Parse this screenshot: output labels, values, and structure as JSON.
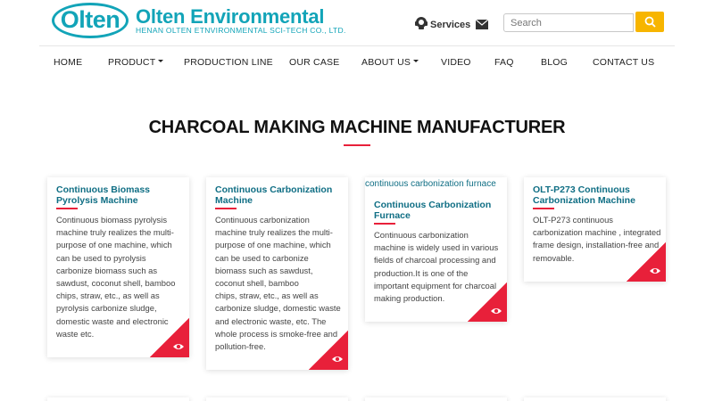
{
  "header": {
    "logo_mark": "Olten",
    "brand_name": "Olten Environmental",
    "brand_sub": "HENAN OLTEN ETNVIRONMENTAL SCI-TECH CO., LTD.",
    "services_label": "Services",
    "search_placeholder": "Search"
  },
  "nav": {
    "items": [
      "HOME",
      "PRODUCT",
      "PRODUCTION LINE",
      "OUR CASE",
      "ABOUT US",
      "VIDEO",
      "FAQ",
      "BLOG",
      "CONTACT US"
    ]
  },
  "section": {
    "title": "CHARCOAL MAKING MACHINE MANUFACTURER"
  },
  "cards": [
    {
      "title_lines": [
        "Continuous Biomass",
        "Pyrolysis Machine"
      ],
      "desc_lines": [
        "Continuous biomass pyrolysis",
        "machine truly realizes the multi-",
        "purpose of one machine, which",
        "can be used to pyrolysis",
        "carbonize biomass such as",
        "sawdust, coconut shell, bamboo",
        "chips, straw, etc., as well as",
        "pyrolysis carbonize sludge,",
        "domestic waste and electronic",
        "waste etc."
      ]
    },
    {
      "title_lines": [
        "Continuous Carbonization",
        "Machine"
      ],
      "desc_lines": [
        "Continuous carbonization",
        "machine truly realizes the multi-",
        "purpose of one machine, which",
        "can be used to carbonize",
        "biomass such as sawdust,",
        "coconut shell, bamboo",
        "chips, straw, etc., as well as",
        "carbonize sludge, domestic waste",
        "and electronic waste, etc. The",
        "whole process is smoke-free and",
        "pollution-free."
      ]
    },
    {
      "image_alt": "continuous carbonization furnace",
      "title_lines": [
        "Continuous Carbonization",
        "Furnace"
      ],
      "desc_lines": [
        "Continuous carbonization",
        "machine is widely used in various",
        "fields of charcoal processing and",
        "production.It is one of the",
        "important equipment for charcoal",
        "making production."
      ]
    },
    {
      "title_lines": [
        "OLT-P273 Continuous",
        "Carbonization Machine"
      ],
      "desc_lines": [
        "OLT-P273 continuous",
        "carbonization machine , integrated",
        "frame design, installation-free and",
        "removable."
      ]
    }
  ]
}
